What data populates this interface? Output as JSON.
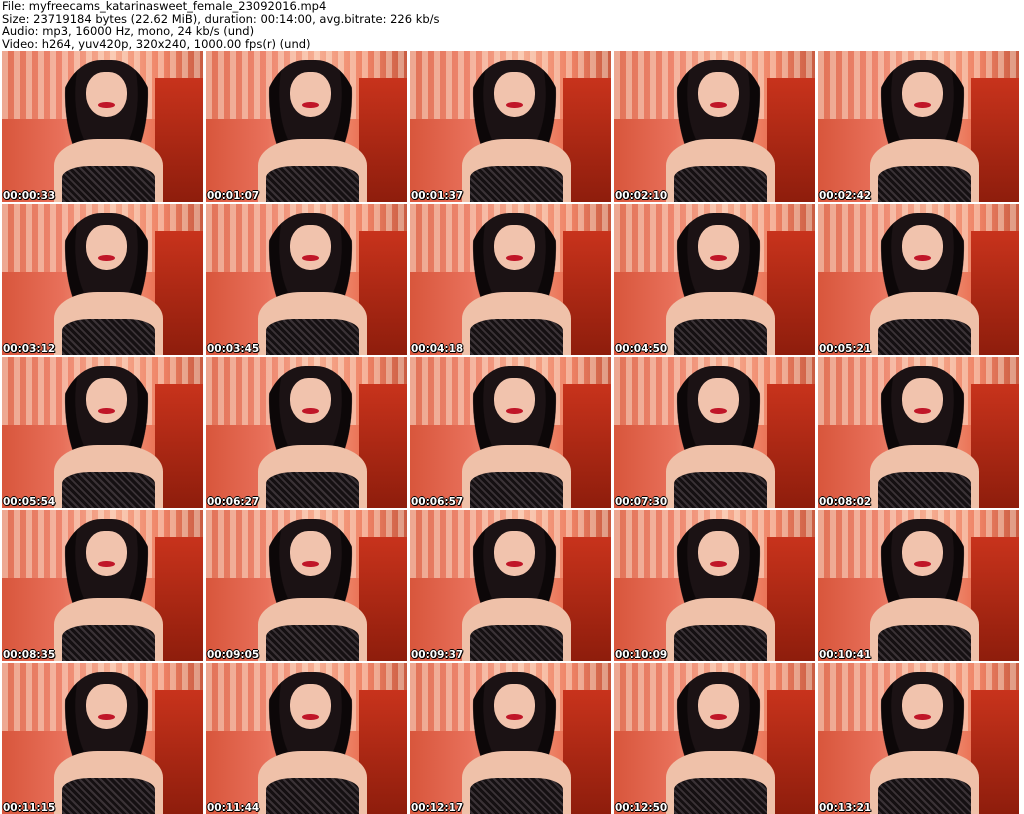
{
  "header": {
    "file": "File: myfreecams_katarinasweet_female_23092016.mp4",
    "size": "Size: 23719184 bytes (22.62 MiB), duration: 00:14:00, avg.bitrate: 226 kb/s",
    "audio": "Audio: mp3, 16000 Hz, mono, 24 kb/s (und)",
    "video": "Video: h264, yuv420p, 320x240, 1000.00 fps(r) (und)"
  },
  "thumbnails": [
    {
      "timestamp": "00:00:33"
    },
    {
      "timestamp": "00:01:07"
    },
    {
      "timestamp": "00:01:37"
    },
    {
      "timestamp": "00:02:10"
    },
    {
      "timestamp": "00:02:42"
    },
    {
      "timestamp": "00:03:12"
    },
    {
      "timestamp": "00:03:45"
    },
    {
      "timestamp": "00:04:18"
    },
    {
      "timestamp": "00:04:50"
    },
    {
      "timestamp": "00:05:21"
    },
    {
      "timestamp": "00:05:54"
    },
    {
      "timestamp": "00:06:27"
    },
    {
      "timestamp": "00:06:57"
    },
    {
      "timestamp": "00:07:30"
    },
    {
      "timestamp": "00:08:02"
    },
    {
      "timestamp": "00:08:35"
    },
    {
      "timestamp": "00:09:05"
    },
    {
      "timestamp": "00:09:37"
    },
    {
      "timestamp": "00:10:09"
    },
    {
      "timestamp": "00:10:41"
    },
    {
      "timestamp": "00:11:15"
    },
    {
      "timestamp": "00:11:44"
    },
    {
      "timestamp": "00:12:17"
    },
    {
      "timestamp": "00:12:50"
    },
    {
      "timestamp": "00:13:21"
    }
  ]
}
